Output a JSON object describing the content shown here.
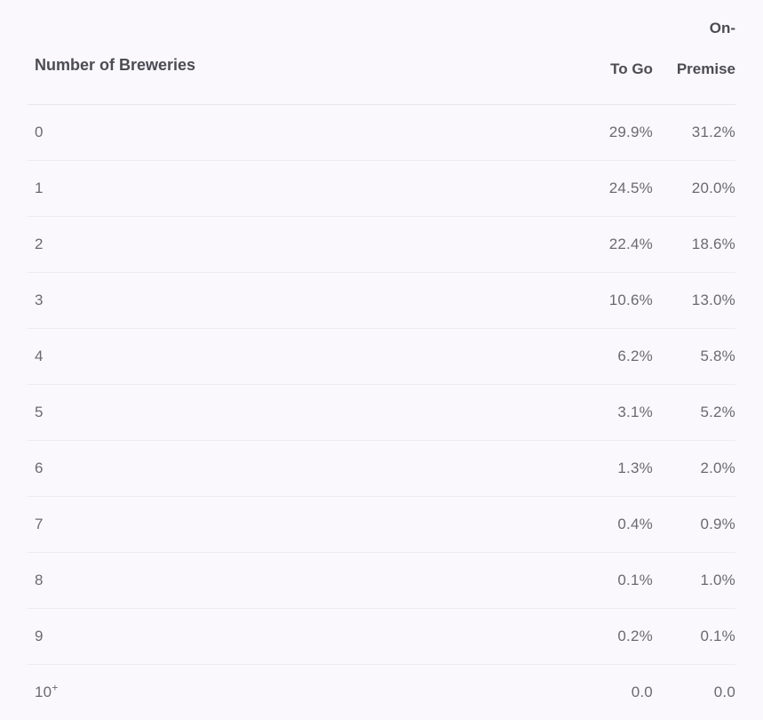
{
  "table": {
    "row_header_label": "Number of Breweries",
    "columns": [
      {
        "key": "to_go",
        "label": "To Go"
      },
      {
        "key": "on_premise",
        "label": "On-Premise"
      }
    ],
    "rows": [
      {
        "label": "0",
        "label_sup": "",
        "to_go": "29.9%",
        "on_premise": "31.2%"
      },
      {
        "label": "1",
        "label_sup": "",
        "to_go": "24.5%",
        "on_premise": "20.0%"
      },
      {
        "label": "2",
        "label_sup": "",
        "to_go": "22.4%",
        "on_premise": "18.6%"
      },
      {
        "label": "3",
        "label_sup": "",
        "to_go": "10.6%",
        "on_premise": "13.0%"
      },
      {
        "label": "4",
        "label_sup": "",
        "to_go": "6.2%",
        "on_premise": "5.8%"
      },
      {
        "label": "5",
        "label_sup": "",
        "to_go": "3.1%",
        "on_premise": "5.2%"
      },
      {
        "label": "6",
        "label_sup": "",
        "to_go": "1.3%",
        "on_premise": "2.0%"
      },
      {
        "label": "7",
        "label_sup": "",
        "to_go": "0.4%",
        "on_premise": "0.9%"
      },
      {
        "label": "8",
        "label_sup": "",
        "to_go": "0.1%",
        "on_premise": "1.0%"
      },
      {
        "label": "9",
        "label_sup": "",
        "to_go": "0.2%",
        "on_premise": "0.1%"
      },
      {
        "label": "10",
        "label_sup": "+",
        "to_go": "0.0",
        "on_premise": "0.0"
      }
    ]
  },
  "colors": {
    "page_background": "#faf8fc",
    "header_text": "#4c4c55",
    "body_text": "#6a6a74",
    "header_rule": "#e7e4ef",
    "row_rule": "#eceaf3"
  }
}
